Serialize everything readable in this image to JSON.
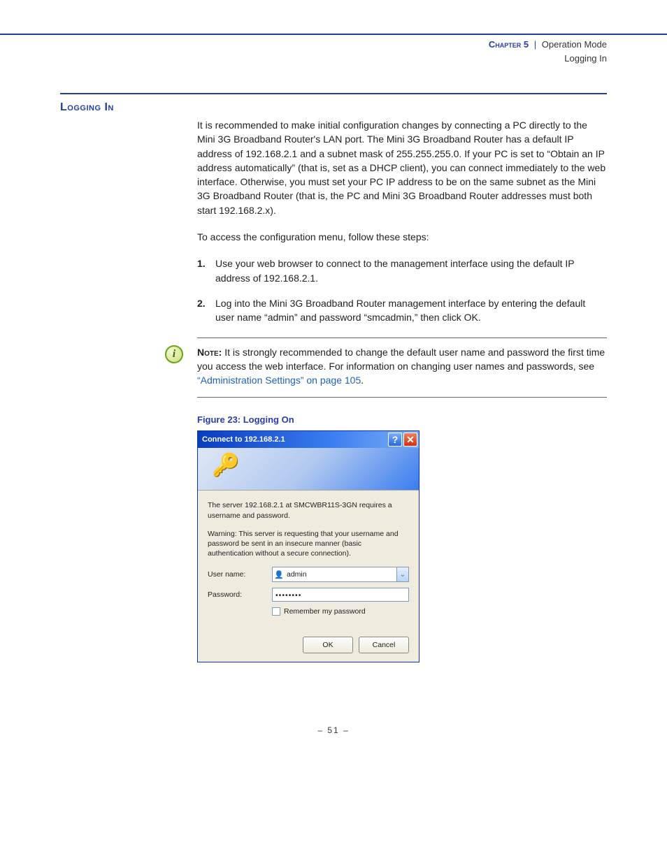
{
  "header": {
    "chapter": "Chapter 5",
    "section": "Operation Mode",
    "subsection": "Logging In"
  },
  "title": "Logging In",
  "para1": "It is recommended to make initial configuration changes by connecting a PC directly to the Mini 3G Broadband Router's LAN port. The Mini 3G Broadband Router has a default IP address of 192.168.2.1 and a subnet mask of 255.255.255.0. If your PC is set to “Obtain an IP address automatically” (that is, set as a DHCP client), you can connect immediately to the web interface. Otherwise, you must set your PC IP address to be on the same subnet as the Mini 3G Broadband Router (that is, the PC and Mini 3G Broadband Router addresses must both start 192.168.2.x).",
  "para2": "To access the configuration menu, follow these steps:",
  "steps": [
    "Use your web browser to connect to the management interface using the default IP address of 192.168.2.1.",
    "Log into the Mini 3G Broadband Router management interface by entering the default user name “admin” and password “smcadmin,” then click OK."
  ],
  "note": {
    "label": "Note:",
    "text": " It is strongly recommended to change the default user name and password the first time you access the web interface. For information on changing user names and passwords, see ",
    "link": "“Administration Settings” on page 105",
    "tail": "."
  },
  "figure_caption": "Figure 23:  Logging On",
  "dialog": {
    "title": "Connect to 192.168.2.1",
    "msg1": "The server 192.168.2.1 at SMCWBR11S-3GN requires a username and password.",
    "msg2": "Warning: This server is requesting that your username and password be sent in an insecure manner (basic authentication without a secure connection).",
    "username_label": "User name:",
    "username_value": "admin",
    "password_label": "Password:",
    "password_value": "••••••••",
    "remember_label": "Remember my password",
    "ok": "OK",
    "cancel": "Cancel"
  },
  "page_number": "–  51  –"
}
